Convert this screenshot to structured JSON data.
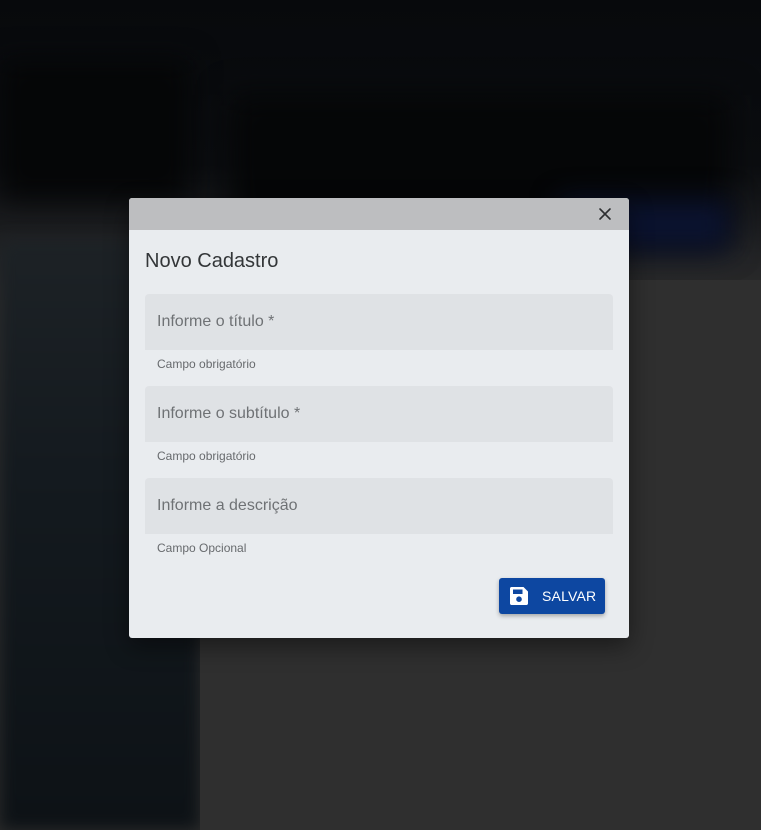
{
  "dialog": {
    "title": "Novo Cadastro",
    "close_icon": "close-icon",
    "fields": [
      {
        "placeholder": "Informe o título *",
        "value": "",
        "hint": "Campo obrigatório"
      },
      {
        "placeholder": "Informe o subtítulo *",
        "value": "",
        "hint": "Campo obrigatório"
      },
      {
        "placeholder": "Informe a descrição",
        "value": "",
        "hint": "Campo Opcional"
      }
    ],
    "save_button": {
      "label": "SALVAR",
      "icon": "floppy-disk-icon"
    }
  },
  "colors": {
    "dialog_background": "#e9ecef",
    "dialog_bar": "#bdbec0",
    "field_background": "#dfe2e5",
    "primary": "#0d47a1"
  }
}
